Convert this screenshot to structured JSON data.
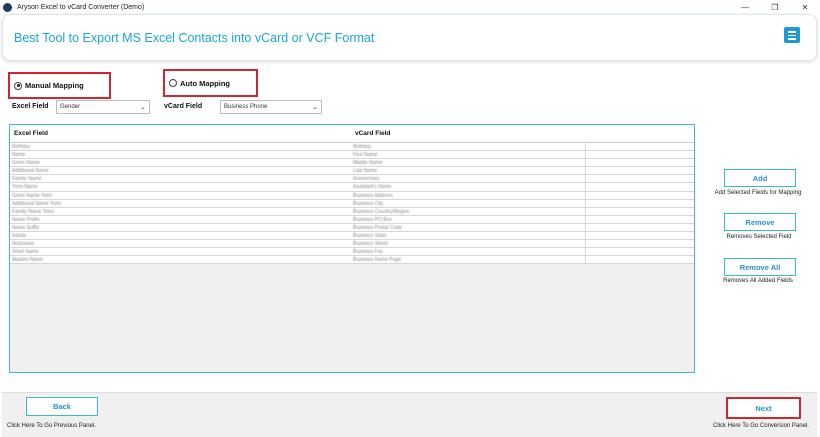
{
  "window": {
    "title": "Aryson Excel to vCard Converter (Demo)",
    "controls": [
      "—",
      "❐",
      "✕"
    ]
  },
  "banner": {
    "heading": "Best Tool to Export MS Excel Contacts into vCard or VCF Format"
  },
  "mapping": {
    "manual_label": "Manual Mapping",
    "auto_label": "Auto Mapping",
    "selected": "manual"
  },
  "fields": {
    "excel_label": "Excel Field",
    "excel_value": "Gender",
    "vcard_label": "vCard Field",
    "vcard_value": "Business Phone"
  },
  "grid": {
    "headers": [
      "Excel Field",
      "vCard Field"
    ],
    "rows": [
      [
        "Birthday",
        "Birthday"
      ],
      [
        "Name",
        "First Name"
      ],
      [
        "Given Name",
        "Middle Name"
      ],
      [
        "Additional Name",
        "Last Name"
      ],
      [
        "Family Name",
        "Anniversary"
      ],
      [
        "Yomi Name",
        "Assistant's Name"
      ],
      [
        "Given Name Yomi",
        "Business Address"
      ],
      [
        "Additional Name Yomi",
        "Business City"
      ],
      [
        "Family Name Yomi",
        "Business Country/Region"
      ],
      [
        "Name Prefix",
        "Business PO Box"
      ],
      [
        "Name Suffix",
        "Business Postal Code"
      ],
      [
        "Initials",
        "Business State"
      ],
      [
        "Nickname",
        "Business Street"
      ],
      [
        "Short Name",
        "Business Fax"
      ],
      [
        "Maiden Name",
        "Business Home Page"
      ]
    ]
  },
  "actions": {
    "add_label": "Add",
    "add_caption": "Add Selected Fields for Mapping",
    "remove_label": "Remove",
    "remove_caption": "Removes Selected Field",
    "remove_all_label": "Remove All",
    "remove_all_caption": "Removes All Added Fields"
  },
  "footer": {
    "back_label": "Back",
    "back_caption": "Click Here To Go Previous Panel.",
    "next_label": "Next",
    "next_caption": "Click Here To Go Conversion Panel."
  },
  "colors": {
    "accent": "#17a7d6",
    "button_text": "#2a8fd0",
    "highlight": "#d02535"
  }
}
